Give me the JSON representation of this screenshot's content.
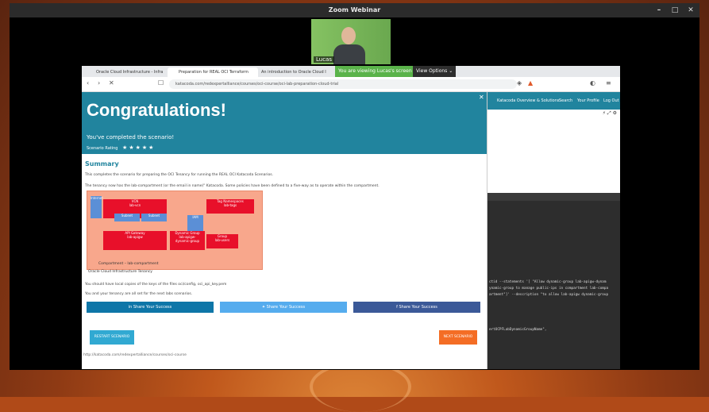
{
  "window": {
    "title": "Zoom Webinar",
    "controls": [
      "–",
      "□",
      "✕"
    ]
  },
  "video": {
    "participant_name": "Lucas"
  },
  "browser": {
    "tabs": [
      {
        "label": "Oracle Cloud Infrastructure - Infra"
      },
      {
        "label": "Preparation for REAL OCI Terraform"
      },
      {
        "label": "An introduction to Oracle Cloud I"
      }
    ],
    "viewing_banner": "You are viewing Lucas's screen",
    "view_options": "View Options ⌄",
    "url": "katacoda.com/redexpertalliance/courses/oci-course/oci-lab-preparation-cloud-trial"
  },
  "modal": {
    "title": "Congratulations!",
    "subtitle": "You've completed the scenario!",
    "rating_label": "Scenario Rating",
    "stars": "★★★★★",
    "summary_heading": "Summary",
    "para1": "This completes the scenario for preparing the OCI Tenancy for running the REAL OCI Katacoda Scenarios.",
    "para2": "The tenancy now has the lab-compartment (or the email in name)\" Katacoda. Some policies have been defined to a five-way as to operate within the compartment.",
    "para3": "You should have local copies of the keys of the files oci/config, oci_api_key.pem",
    "para4": "You and your tenancy are all set for the next labs scenarios.",
    "diagram": {
      "caption": "Compartment – lab-compartment",
      "boxes": [
        "VCN\nlab-vcn",
        "Tag Namespaces\nlab-tags",
        "API Gateway\nlab-apigw",
        "Dynamic Group\nlab-apigw-\ndynamic-group",
        "Group\nlab-users",
        "Subnet",
        "Subnet",
        "IAM",
        "Internet"
      ]
    },
    "oracle_caption": "Oracle Cloud Infrastructure    Tenancy",
    "share_buttons": [
      "Share Your Success",
      "Share Your Success",
      "Share Your Success"
    ],
    "restart_label": "RESTART SCENARIO",
    "next_label": "NEXT SCENARIO",
    "footer_link": "http://katacoda.com/redexpertalliance/courses/oci-course"
  },
  "right_panel": {
    "nav": [
      "Katacoda Overview & Solutions",
      "Search",
      "Your Profile",
      "Log Out"
    ],
    "tools": "⚡ ⤢ ⚙",
    "terminal_lines": [
      "ctid  --statements '[ \"Allow dynamic-group lab-apigw-dynam",
      "ynamic-group to manage public-ips in compartment lab-compa",
      "artment\"]' --description \"to allow lab-apigw dynamic-group",
      "",
      "",
      "ertOCPFLabDynamicGroupName\","
    ]
  },
  "colors": {
    "teal": "#21849e",
    "zoom_green": "#5ab34a"
  }
}
